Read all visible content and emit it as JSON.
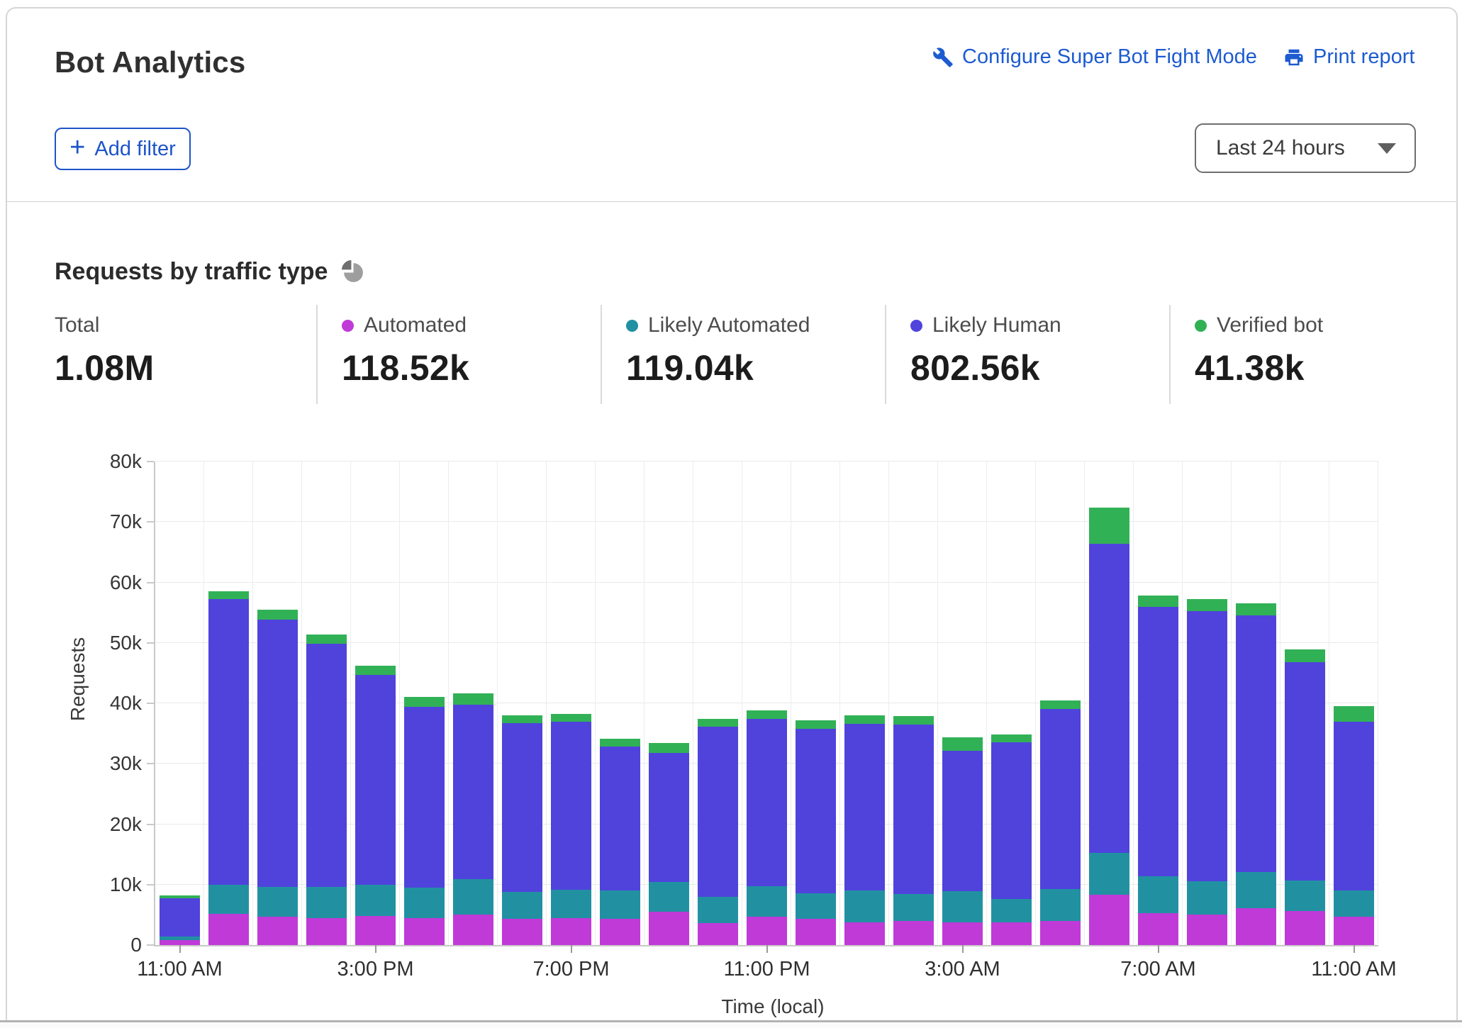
{
  "header": {
    "title": "Bot Analytics",
    "configure_link": "Configure Super Bot Fight Mode",
    "print_link": "Print report",
    "add_filter_plus": "+",
    "add_filter": "Add filter",
    "time_range": "Last 24 hours"
  },
  "section": {
    "heading": "Requests by traffic type"
  },
  "stats": [
    {
      "label": "Total",
      "value": "1.08M",
      "color": ""
    },
    {
      "label": "Automated",
      "value": "118.52k",
      "color": "#c03ad8"
    },
    {
      "label": "Likely Automated",
      "value": "119.04k",
      "color": "#2090a2"
    },
    {
      "label": "Likely Human",
      "value": "802.56k",
      "color": "#5044dc"
    },
    {
      "label": "Verified bot",
      "value": "41.38k",
      "color": "#30b155"
    }
  ],
  "chart_data": {
    "type": "bar",
    "stacked": true,
    "title": "Requests by traffic type",
    "xlabel": "Time (local)",
    "ylabel": "Requests",
    "unit": "thousands of requests",
    "ylim": [
      0,
      80000
    ],
    "grid": true,
    "yticks": [
      "0",
      "10k",
      "20k",
      "30k",
      "40k",
      "50k",
      "60k",
      "70k",
      "80k"
    ],
    "xtick_labels": [
      "11:00 AM",
      "3:00 PM",
      "7:00 PM",
      "11:00 PM",
      "3:00 AM",
      "7:00 AM",
      "11:00 AM"
    ],
    "xtick_slots": [
      0,
      4,
      8,
      12,
      16,
      20,
      24
    ],
    "categories": [
      "11:00 AM",
      "12:00 PM",
      "1:00 PM",
      "2:00 PM",
      "3:00 PM",
      "4:00 PM",
      "5:00 PM",
      "6:00 PM",
      "7:00 PM",
      "8:00 PM",
      "9:00 PM",
      "10:00 PM",
      "11:00 PM",
      "12:00 AM",
      "1:00 AM",
      "2:00 AM",
      "3:00 AM",
      "4:00 AM",
      "5:00 AM",
      "6:00 AM",
      "7:00 AM",
      "8:00 AM",
      "9:00 AM",
      "10:00 AM",
      "11:00 AM"
    ],
    "series": [
      {
        "name": "Automated",
        "color": "#c03ad8",
        "values": [
          0.8,
          5.2,
          4.7,
          4.5,
          4.8,
          4.5,
          5.0,
          4.3,
          4.5,
          4.3,
          5.5,
          3.6,
          4.7,
          4.3,
          3.8,
          4.0,
          3.8,
          3.7,
          4.0,
          8.3,
          5.3,
          5.1,
          6.1,
          5.6,
          4.7
        ]
      },
      {
        "name": "Likely Automated",
        "color": "#2191a2",
        "values": [
          0.6,
          4.8,
          4.9,
          5.1,
          5.2,
          5.0,
          5.9,
          4.5,
          4.7,
          4.7,
          4.9,
          4.4,
          5.0,
          4.3,
          5.2,
          4.5,
          5.1,
          3.9,
          5.3,
          6.9,
          6.1,
          5.5,
          6.0,
          5.1,
          4.3
        ]
      },
      {
        "name": "Likely Human",
        "color": "#4f43dc",
        "values": [
          6.3,
          47.2,
          44.2,
          40.3,
          34.7,
          29.9,
          28.9,
          27.9,
          27.7,
          23.8,
          21.4,
          28.1,
          27.7,
          27.2,
          27.6,
          28.0,
          23.2,
          25.9,
          29.8,
          51.2,
          44.5,
          44.6,
          42.4,
          36.1,
          27.9
        ]
      },
      {
        "name": "Verified bot",
        "color": "#31b156",
        "values": [
          0.5,
          1.3,
          1.7,
          1.5,
          1.5,
          1.7,
          1.8,
          1.3,
          1.4,
          1.3,
          1.6,
          1.3,
          1.4,
          1.4,
          1.4,
          1.4,
          2.3,
          1.4,
          1.4,
          6.0,
          1.9,
          2.1,
          2.0,
          2.1,
          2.6
        ]
      }
    ],
    "legend_position": "top"
  }
}
